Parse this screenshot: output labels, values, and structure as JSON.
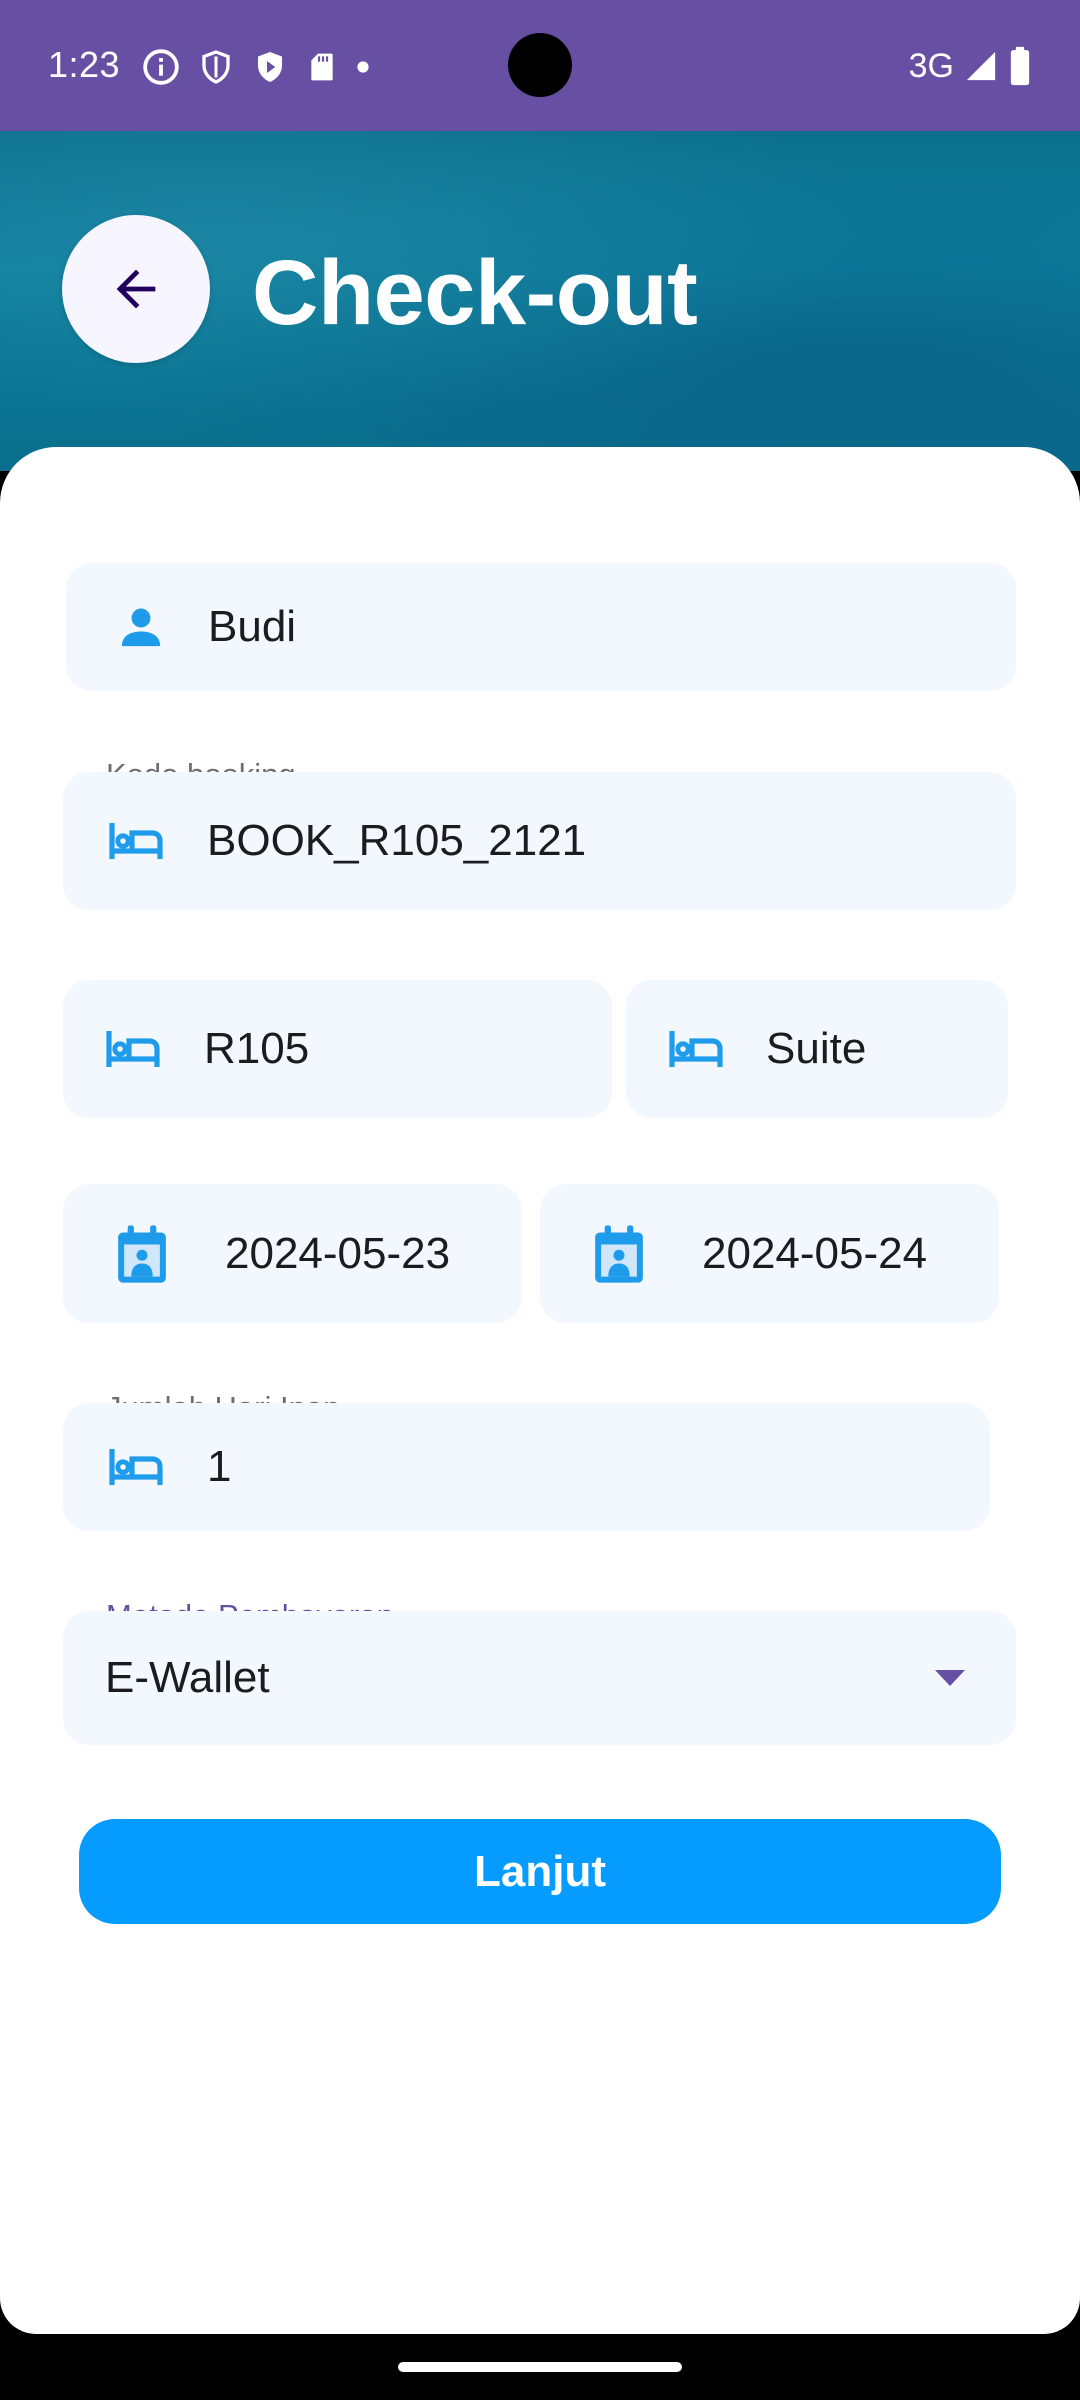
{
  "status_bar": {
    "time": "1:23",
    "network": "3G",
    "left_icons": [
      "info-icon",
      "shield-icon",
      "play-shield-icon",
      "sd-card-icon",
      "dot-icon"
    ],
    "right_icons": [
      "signal-icon",
      "battery-icon"
    ]
  },
  "header": {
    "title": "Check-out",
    "back_icon": "arrow-left-icon"
  },
  "form": {
    "guest_name": {
      "value": "Budi",
      "icon": "person-icon"
    },
    "booking_code": {
      "label": "Kode booking",
      "value": "BOOK_R105_2121",
      "icon": "bed-icon"
    },
    "room_number": {
      "value": "R105",
      "icon": "bed-icon"
    },
    "room_type": {
      "value": "Suite",
      "icon": "bed-icon"
    },
    "check_in_date": {
      "value": "2024-05-23",
      "icon": "calendar-icon"
    },
    "check_out_date": {
      "value": "2024-05-24",
      "icon": "calendar-icon"
    },
    "nights": {
      "label": "Jumlah Hari Inap",
      "value": "1",
      "icon": "bed-icon"
    },
    "payment_method": {
      "label": "Metode Pembayaran",
      "value": "E-Wallet",
      "icon": "dropdown-arrow-icon"
    }
  },
  "actions": {
    "continue_label": "Lanjut"
  },
  "colors": {
    "status_bar": "#6750A4",
    "accent_blue": "#069BFF",
    "icon_blue": "#1E9BEA",
    "field_bg": "#F3F8FE",
    "label_purple": "#6750A4"
  }
}
